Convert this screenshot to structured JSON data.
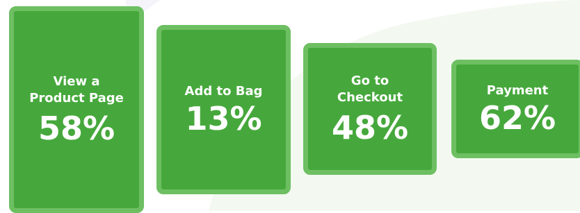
{
  "theme": {
    "card_fill": "#46a83c",
    "card_border": "#6dbf62",
    "text_color": "#ffffff",
    "background_shape": "#f3f9f1"
  },
  "funnel": {
    "steps": [
      {
        "label": "View a\nProduct Page",
        "value": "58%"
      },
      {
        "label": "Add to Bag",
        "value": "13%"
      },
      {
        "label": "Go to\nCheckout",
        "value": "48%"
      },
      {
        "label": "Payment",
        "value": "62%"
      }
    ]
  }
}
